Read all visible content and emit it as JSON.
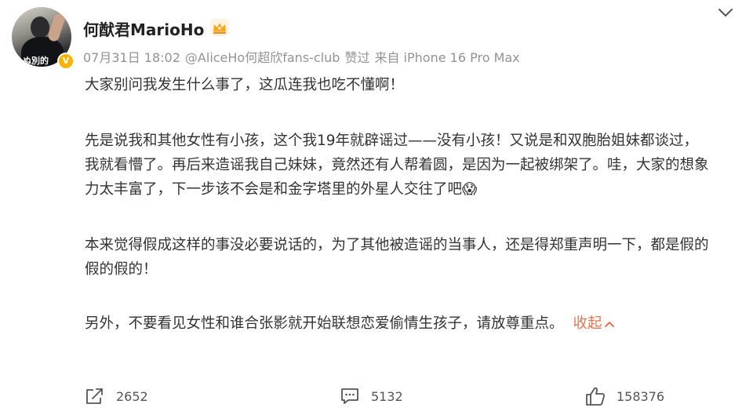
{
  "user": {
    "name": "何猷君MarioHo",
    "avatar_text": "ぬ別的",
    "verified_mark": "V"
  },
  "meta": {
    "date": "07月31日 18:02",
    "mention": "@AliceHo何超欣fans-club",
    "action": "赞过",
    "source": "来自 iPhone 16 Pro Max"
  },
  "post": {
    "p1": "大家别问我发生什么事了，这瓜连我也吃不懂啊！",
    "p2": "先是说我和其他女性有小孩，这个我19年就辟谣过——没有小孩！又说是和双胞胎姐妹都谈过，我就看懵了。再后来造谣我自己妹妹，竟然还有人帮着圆，是因为一起被绑架了。哇，大家的想象力太丰富了，下一步该不会是和金字塔里的外星人交往了吧",
    "p2_emoji": "😱",
    "p3": "本来觉得假成这样的事没必要说话的，为了其他被造谣的当事人，还是得郑重声明一下，都是假的假的假的！",
    "p4": "另外，不要看见女性和谁合张影就开始联想恋爱偷情生孩子，请放尊重点。",
    "collapse_label": "收起"
  },
  "stats": {
    "reposts": "2652",
    "comments": "5132",
    "likes": "158376"
  },
  "icons": {
    "crown": "crown-icon",
    "more": "chevron-down-icon",
    "share": "share-icon",
    "comment": "comment-icon",
    "like": "thumbs-up-icon"
  },
  "colors": {
    "accent": "#eb7350",
    "meta_text": "#939393",
    "crown": "#f5a623",
    "verified": "#f7b500"
  }
}
